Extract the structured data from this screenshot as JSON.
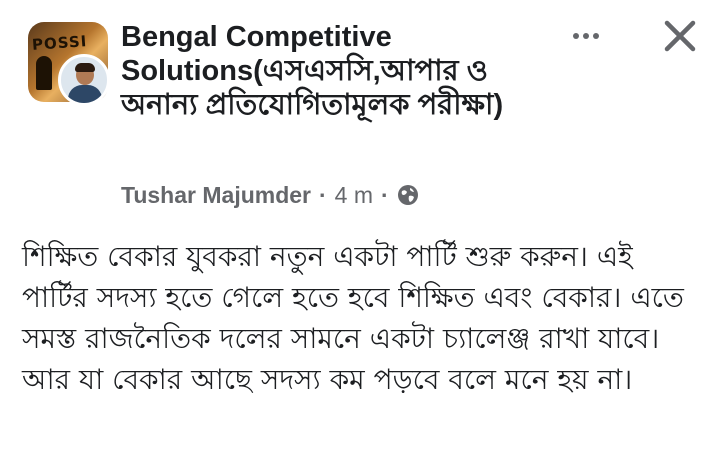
{
  "post": {
    "group_name": "Bengal Competitive Solutions(এসএসসি,আপার ও অনান্য প্রতিযোগিতামূলক পরীক্ষা)",
    "author": "Tushar Majumder",
    "separator": "·",
    "time": "4 m",
    "privacy_icon": "globe-icon",
    "group_avatar_text": "POSSI",
    "more_icon": "more-horizontal-icon",
    "close_icon": "close-icon",
    "body": "শিক্ষিত বেকার যুবকরা নতুন একটা পার্টি শুরু করুন। এই পার্টির সদস্য হতে গেলে হতে হবে শিক্ষিত এবং বেকার। এতে সমস্ত রাজনৈতিক দলের সামনে একটা চ্যালেঞ্জ রাখা যাবে। আর যা বেকার আছে সদস্য কম পড়বে বলে মনে হয় না।"
  },
  "colors": {
    "text_primary": "#1c1e21",
    "text_secondary": "#65676b",
    "background": "#ffffff"
  }
}
